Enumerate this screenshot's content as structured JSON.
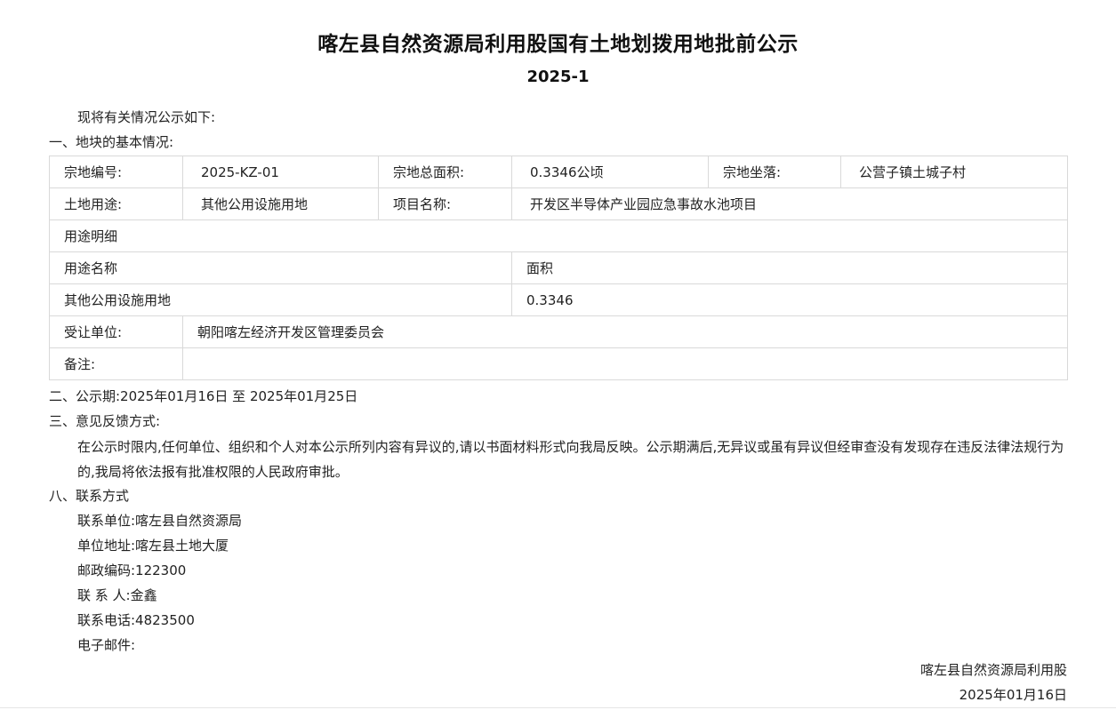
{
  "title": "喀左县自然资源局利用股国有土地划拨用地批前公示",
  "subtitle": "2025-1",
  "intro": "现将有关情况公示如下:",
  "section1_heading": "一、地块的基本情况:",
  "table": {
    "parcel_no_label": "宗地编号:",
    "parcel_no_value": "2025-KZ-01",
    "total_area_label": "宗地总面积:",
    "total_area_value": "0.3346公顷",
    "location_label": "宗地坐落:",
    "location_value": "公营子镇土城子村",
    "land_use_label": "土地用途:",
    "land_use_value": "其他公用设施用地",
    "project_name_label": "项目名称:",
    "project_name_value": "开发区半导体产业园应急事故水池项目",
    "use_detail_label": "用途明细",
    "use_name_header": "用途名称",
    "area_header": "面积",
    "use_rows": [
      {
        "name": "其他公用设施用地",
        "area": "0.3346"
      }
    ],
    "grantee_label": "受让单位:",
    "grantee_value": "朝阳喀左经济开发区管理委员会",
    "remark_label": "备注:",
    "remark_value": ""
  },
  "section2": "二、公示期:2025年01月16日 至 2025年01月25日",
  "section3_heading": "三、意见反馈方式:",
  "feedback_text": "在公示时限内,任何单位、组织和个人对本公示所列内容有异议的,请以书面材料形式向我局反映。公示期满后,无异议或虽有异议但经审查没有发现存在违反法律法规行为的,我局将依法报有批准权限的人民政府审批。",
  "section8_heading": "八、联系方式",
  "contact": {
    "unit": "联系单位:喀左县自然资源局",
    "address": "单位地址:喀左县土地大厦",
    "postcode": "邮政编码:122300",
    "person": "联 系 人:金鑫",
    "phone": "联系电话:4823500",
    "email": "电子邮件:"
  },
  "signature": {
    "org": "喀左县自然资源局利用股",
    "date": "2025年01月16日"
  }
}
